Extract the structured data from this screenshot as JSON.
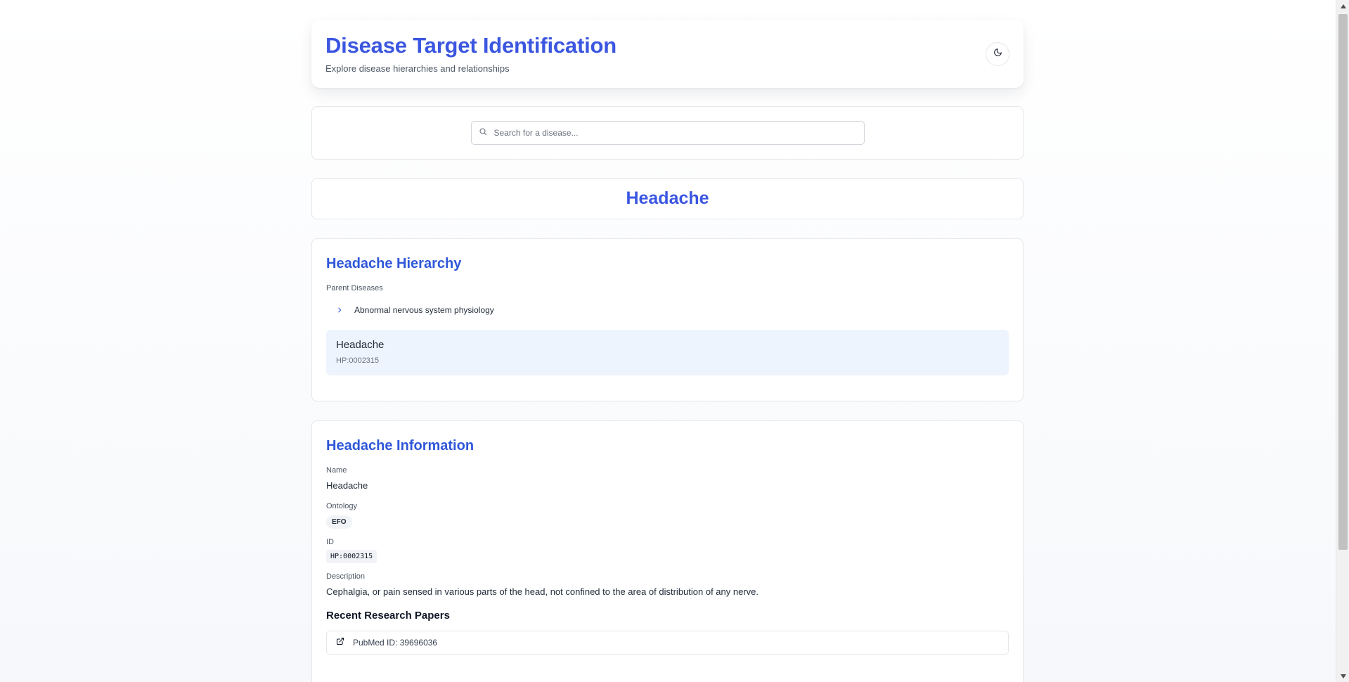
{
  "header": {
    "title": "Disease Target Identification",
    "subtitle": "Explore disease hierarchies and relationships",
    "theme_toggle_icon": "moon-icon"
  },
  "search": {
    "placeholder": "Search for a disease...",
    "value": "",
    "icon": "search-icon"
  },
  "selected_disease": {
    "title": "Headache"
  },
  "hierarchy": {
    "title": "Headache Hierarchy",
    "parents_label": "Parent Diseases",
    "parents": [
      {
        "label": "Abnormal nervous system physiology",
        "icon": "chevron-right-icon"
      }
    ],
    "current": {
      "name": "Headache",
      "id": "HP:0002315"
    }
  },
  "information": {
    "title": "Headache Information",
    "name_label": "Name",
    "name_value": "Headache",
    "ontology_label": "Ontology",
    "ontology_value": "EFO",
    "id_label": "ID",
    "id_value": "HP:0002315",
    "description_label": "Description",
    "description_value": "Cephalgia, or pain sensed in various parts of the head, not confined to the area of distribution of any nerve.",
    "papers_title": "Recent Research Papers",
    "papers": [
      {
        "label": "PubMed ID: 39696036",
        "icon": "external-link-icon"
      }
    ]
  },
  "colors": {
    "accent": "#3b56e0",
    "section_title": "#2f57d9",
    "highlight_bg": "#eef4fd"
  }
}
